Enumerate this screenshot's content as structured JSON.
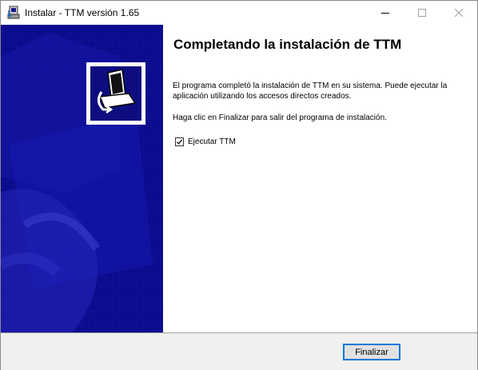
{
  "window": {
    "title": "Instalar - TTM versión 1.65",
    "icon": "installer-icon",
    "controls": [
      "minimize-icon",
      "maximize-icon",
      "close-icon"
    ]
  },
  "content": {
    "heading": "Completando la instalación de TTM",
    "paragraph1": "El programa completó la instalación de TTM en su sistema. Puede ejecutar la aplicación utilizando los accesos directos creados.",
    "paragraph2": "Haga clic en Finalizar para salir del programa de instalación.",
    "run_checkbox": {
      "label": "Ejecutar TTM",
      "checked": true
    }
  },
  "footer": {
    "finish_label": "Finalizar"
  },
  "colors": {
    "side_panel": "#0a0a8c",
    "accent": "#0078d7"
  }
}
